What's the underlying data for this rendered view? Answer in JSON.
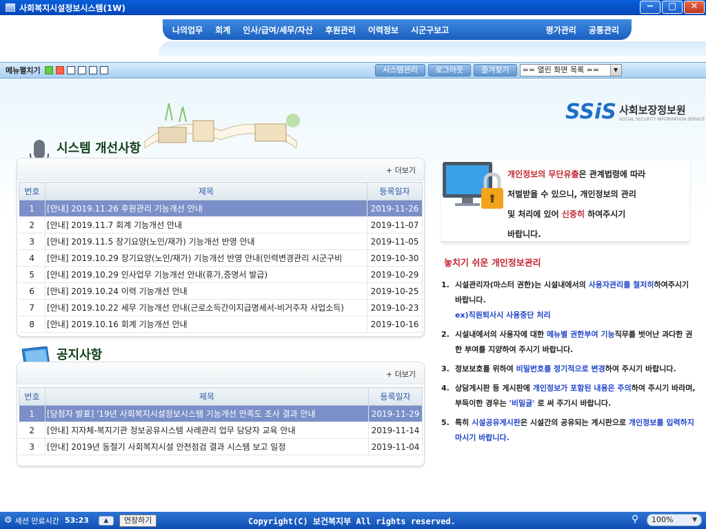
{
  "window": {
    "title": "사회복지시설정보시스템(1W)",
    "min": "−",
    "max": "□",
    "close": "✕"
  },
  "topmenu": {
    "items": [
      "나의업무",
      "회계",
      "인사/급여/세무/자산",
      "후원관리",
      "이력정보",
      "시군구보고"
    ],
    "right_items": [
      "평가관리",
      "공통관리"
    ]
  },
  "toolbar": {
    "menu_toggle": "메뉴펼치기",
    "system_button": "시스템관리",
    "logout_button": "로그아웃",
    "favorites_button": "즐겨찾기",
    "open_screens": "== 열린 화면 목록 =="
  },
  "logo": {
    "mark": "SSiS",
    "name_ko": "사회보장정보원",
    "name_en": "SOCIAL SECURITY INFORMATION SERVICE"
  },
  "improvements": {
    "title": "시스템 개선사항",
    "more": "+ 더보기",
    "headers": [
      "번호",
      "제목",
      "등록일자"
    ],
    "rows": [
      [
        "1",
        "[안내] 2019.11.26 후원관리 기능개선 안내",
        "2019-11-26"
      ],
      [
        "2",
        "[안내] 2019.11.7 회계 기능개선 안내",
        "2019-11-07"
      ],
      [
        "3",
        "[안내] 2019.11.5 장기요양(노인/재가) 기능개선 반영 안내",
        "2019-11-05"
      ],
      [
        "4",
        "[안내] 2019.10.29 장기요양(노인/재가) 기능개선 반영 안내(인력변경관리 시군구비",
        "2019-10-30"
      ],
      [
        "5",
        "[안내] 2019.10.29 인사업무 기능개선 안내(휴가,증명서 발급)",
        "2019-10-29"
      ],
      [
        "6",
        "[안내] 2019.10.24 이력 기능개선 안내",
        "2019-10-25"
      ],
      [
        "7",
        "[안내] 2019.10.22 세무 기능개선 안내(근로소득간이지급명세서-비거주자 사업소득)",
        "2019-10-23"
      ],
      [
        "8",
        "[안내] 2019.10.16 회계 기능개선 안내",
        "2019-10-16"
      ]
    ]
  },
  "notices": {
    "title": "공지사항",
    "more": "+ 더보기",
    "headers": [
      "번호",
      "제목",
      "등록일자"
    ],
    "rows": [
      [
        "1",
        "[당첨자 발표] '19년 사회복지시설정보시스템 기능개선 만족도 조사 결과 안내",
        "2019-11-29"
      ],
      [
        "2",
        "[안내] 지자체-복지기관 정보공유시스템 사례관리 업무 담당자 교육 안내",
        "2019-11-14"
      ],
      [
        "3",
        "[안내] 2019년 동절기 사회복지시설 안전점검 결과 시스템 보고 일정",
        "2019-11-04"
      ]
    ]
  },
  "privacy": {
    "l1a": "개인정보의 무단유출",
    "l1b": "은 관계법령에 따라",
    "l2": "처벌받을 수 있으니, 개인정보의 관리",
    "l3a": "및 처리에 있어 ",
    "l3b": "신중히",
    "l3c": " 하여주시기",
    "l4": "바랍니다."
  },
  "tips": {
    "title": "놓치기 쉬운 개인정보관리",
    "t1a": "시설관리자(마스터 권한)는 시설내에서의 ",
    "t1b": "사용자관리를 철저히",
    "t1c": "하여주시기 바랍니다.",
    "t1d": "ex)직원퇴사시 사용중단 처리",
    "t2a": "시설내에서의 사용자에 대한 ",
    "t2b": "메뉴별 권한부여 기능",
    "t2c": "직무를 벗어난 과다한 권한 부여를 지양하여 주시기 바랍니다.",
    "t3a": "정보보호를 위하여 ",
    "t3b": "비밀번호를 정기적으로 변경",
    "t3c": "하여 주시기 바랍니다.",
    "t4a": "상담게시판 등 게시판에 ",
    "t4b": "개인정보가 포함된 내용은 주의",
    "t4c": "하여 주시기 바라며, 부득이한 경우는 ",
    "t4d": "'비밀글'",
    "t4e": " 로 써 주기시 바랍니다.",
    "t5a": "특히 ",
    "t5b": "시설공유게시판",
    "t5c": "은 시설간의 공유되는 게시판으로 ",
    "t5d": "개인정보를 입력하지 마시기 바랍니다."
  },
  "status": {
    "session_label": "세션 만료시간",
    "session_time": "53:23",
    "extend": "연장하기",
    "copyright": "Copyright(C) 보건복지부 All rights reserved.",
    "zoom": "100%"
  },
  "colors": {
    "accent": "#1b5fbe",
    "selected_row": "#7b8fc8",
    "warning": "#c2262f",
    "highlight": "#2145c8"
  }
}
